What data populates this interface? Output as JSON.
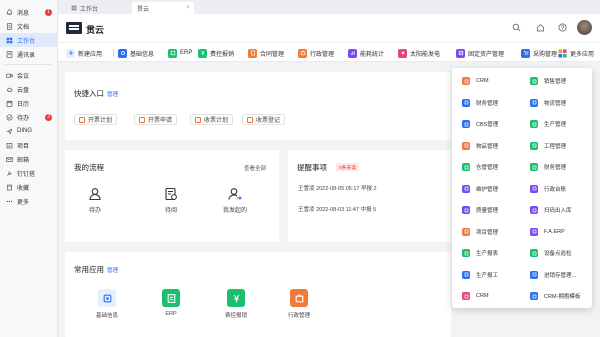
{
  "sidebar": {
    "items": [
      {
        "label": "消息",
        "icon": "bell-icon",
        "badge": "1"
      },
      {
        "label": "文档",
        "icon": "document-icon"
      },
      {
        "label": "工作台",
        "icon": "grid-icon",
        "active": true
      },
      {
        "label": "通讯录",
        "icon": "contacts-icon"
      },
      {
        "label": "会议",
        "icon": "video-icon"
      },
      {
        "label": "云盘",
        "icon": "cloud-icon"
      },
      {
        "label": "日历",
        "icon": "calendar-icon"
      },
      {
        "label": "待办",
        "icon": "check-icon",
        "badge": "3"
      },
      {
        "label": "DING",
        "icon": "ding-icon"
      },
      {
        "label": "项目",
        "icon": "project-icon"
      },
      {
        "label": "邮箱",
        "icon": "mail-icon"
      },
      {
        "label": "钉钉搭",
        "icon": "build-icon"
      },
      {
        "label": "收藏",
        "icon": "star-icon"
      },
      {
        "label": "更多",
        "icon": "more-icon"
      }
    ]
  },
  "tabs": [
    {
      "label": "工作台"
    },
    {
      "label": "贯云",
      "close": "×"
    }
  ],
  "header": {
    "brand": "贯云"
  },
  "apps": [
    {
      "label": "新建应用",
      "icon": "plus-icon",
      "color": "#2b6ff2"
    },
    {
      "label": "基础信息",
      "icon": "gear-icon",
      "color": "#2b6ff2"
    },
    {
      "label": "ERP",
      "icon": "erp-icon",
      "color": "#1bbf6e"
    },
    {
      "label": "费控报销",
      "icon": "money-icon",
      "color": "#1bbf6e"
    },
    {
      "label": "合同管理",
      "icon": "contract-icon",
      "color": "#f07a3a"
    },
    {
      "label": "行政管理",
      "icon": "admin-icon",
      "color": "#f07a3a"
    },
    {
      "label": "能耗统计",
      "icon": "energy-icon",
      "color": "#7a4af0"
    },
    {
      "label": "太阳能发电",
      "icon": "sun-icon",
      "color": "#e8457a"
    },
    {
      "label": "固定资产管理",
      "icon": "asset-icon",
      "color": "#7a4af0"
    },
    {
      "label": "采购管理",
      "icon": "purchase-icon",
      "color": "#2b6ff2"
    },
    {
      "label": "更多应用",
      "icon": "apps-icon",
      "color": "#f0a030"
    }
  ],
  "quick": {
    "title": "快捷入口",
    "manage": "管理",
    "items": [
      "开票计划",
      "开票申请",
      "收票计划",
      "收票登记"
    ]
  },
  "flow": {
    "title": "我的流程",
    "view_all": "查看全部",
    "items": [
      {
        "label": "待办",
        "icon": "user-icon"
      },
      {
        "label": "待阅",
        "icon": "read-icon"
      },
      {
        "label": "我发起的",
        "icon": "user-arrow-icon"
      }
    ]
  },
  "reminder": {
    "title": "提醒事项",
    "tag": "0条未读",
    "rows": [
      {
        "text": "王雪凌 2022-08-05 05:17 早报 2"
      },
      {
        "text": "王雪凌 2022-08-03 11:47 中报 5"
      }
    ]
  },
  "common": {
    "title": "常用应用",
    "manage": "管理",
    "items": [
      {
        "label": "基础信息",
        "icon": "gear-icon",
        "bg": "#e6f0fd",
        "fg": "#2b6ff2"
      },
      {
        "label": "ERP",
        "icon": "erp-icon",
        "bg": "#1bbf6e",
        "fg": "#ffffff"
      },
      {
        "label": "费控报销",
        "icon": "money-icon",
        "bg": "#1bbf6e",
        "fg": "#ffffff"
      },
      {
        "label": "行政管理",
        "icon": "admin-icon",
        "bg": "#f07a3a",
        "fg": "#ffffff"
      }
    ]
  },
  "popup": {
    "items": [
      {
        "label": "CRM",
        "color": "#f07a3a"
      },
      {
        "label": "销售管理",
        "color": "#1bbf6e"
      },
      {
        "label": "财务管理",
        "color": "#2b6ff2"
      },
      {
        "label": "物流管理",
        "color": "#2b6ff2"
      },
      {
        "label": "CBS管理",
        "color": "#2b6ff2"
      },
      {
        "label": "生产管理",
        "color": "#1bbf6e"
      },
      {
        "label": "物品管理",
        "color": "#f07a3a"
      },
      {
        "label": "工程管理",
        "color": "#1bbf6e"
      },
      {
        "label": "仓管管理",
        "color": "#1bbf6e"
      },
      {
        "label": "财务管理",
        "color": "#1bbf6e"
      },
      {
        "label": "维护管理",
        "color": "#7a4af0"
      },
      {
        "label": "行政台账",
        "color": "#7a4af0"
      },
      {
        "label": "质量管理",
        "color": "#7a4af0"
      },
      {
        "label": "扫码出入库",
        "color": "#7a4af0"
      },
      {
        "label": "项目管理",
        "color": "#f07a3a"
      },
      {
        "label": "F.A.ERP",
        "color": "#7a4af0"
      },
      {
        "label": "生产报表",
        "color": "#1bbf6e"
      },
      {
        "label": "设备点巡检",
        "color": "#1bbf6e"
      },
      {
        "label": "生产报工",
        "color": "#2b6ff2"
      },
      {
        "label": "进销存管理...",
        "color": "#2b6ff2"
      },
      {
        "label": "CRM",
        "color": "#e8457a"
      },
      {
        "label": "CRM-拥抱模板",
        "color": "#2b6ff2"
      }
    ]
  }
}
